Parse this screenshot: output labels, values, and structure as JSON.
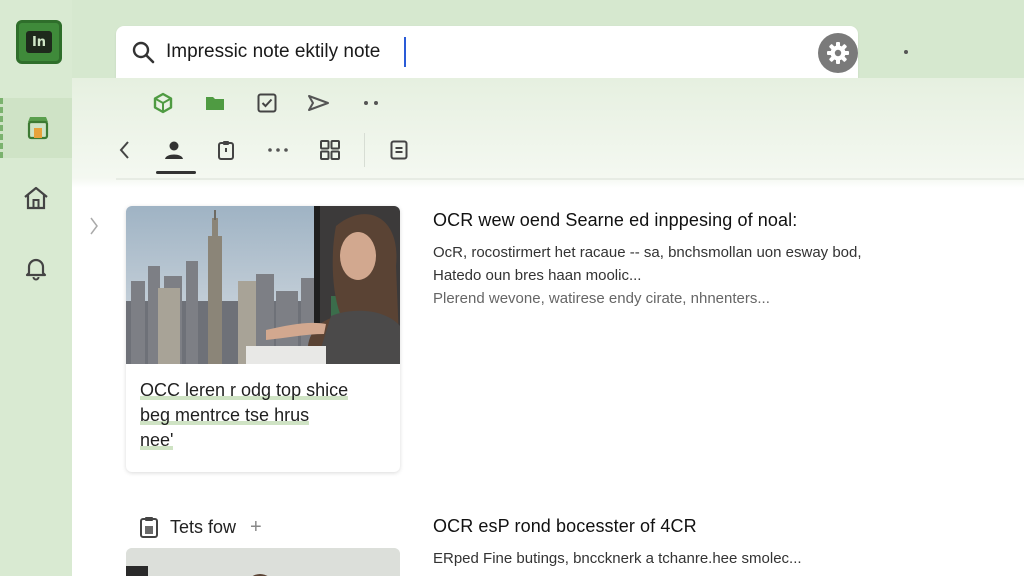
{
  "search": {
    "value": "Impressic note ektily note"
  },
  "card": {
    "lines": [
      "OCC leren r odg top shice",
      "beg mentrce tse hrus",
      "nee'"
    ]
  },
  "article1": {
    "title": "OCR wew oend Searne ed inppesing of noal:",
    "lines": [
      "OcR, rocostirmert het racaue -- sa, bnchsmollan uon esway bod,",
      "Hatedo oun bres haan moolic...",
      "Plerend wevone, watirese endy cirate, nhnenters..."
    ]
  },
  "section2": {
    "label": "Tets fow",
    "plus": "+"
  },
  "article2": {
    "title": "OCR esP rond bocesster of 4CR",
    "lines": [
      "ERped Fine butings, bnccknerk a tchanre.hee smolec..."
    ]
  },
  "colors": {
    "accent": "#3f8a3a",
    "rail_bg": "#d9ead2",
    "cursor": "#2a5bd7"
  },
  "icons": {
    "logo": "app-logo-icon",
    "sidebar": [
      "store-icon",
      "home-icon",
      "bell-icon"
    ],
    "toolbar_row1": [
      "cube-icon",
      "folder-icon",
      "checkbox-icon",
      "send-icon",
      "more-dots-icon"
    ],
    "toolbar_row2": [
      "back-icon",
      "person-icon",
      "clipboard-icon",
      "ellipsis-icon",
      "grid-icon",
      "document-icon"
    ]
  }
}
